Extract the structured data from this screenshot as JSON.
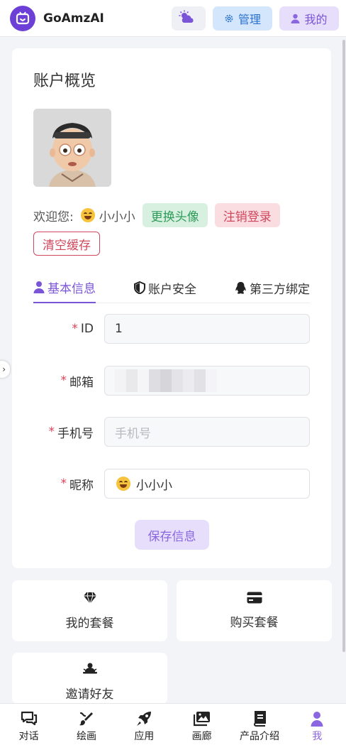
{
  "header": {
    "app_name": "GoAmzAI",
    "admin_label": "管理",
    "me_label": "我的"
  },
  "account": {
    "title": "账户概览",
    "welcome": "欢迎您:",
    "nickname": "小小小",
    "change_avatar": "更换头像",
    "logout": "注销登录",
    "clear_cache": "清空缓存"
  },
  "tabs": [
    {
      "label": "基本信息",
      "active": true
    },
    {
      "label": "账户安全",
      "active": false
    },
    {
      "label": "第三方绑定",
      "active": false
    }
  ],
  "form": {
    "required_mark": "*",
    "id_label": "ID",
    "id_value": "1",
    "email_label": "邮箱",
    "phone_label": "手机号",
    "phone_placeholder": "手机号",
    "nickname_label": "昵称",
    "nickname_value": "小小小",
    "save_label": "保存信息"
  },
  "cards": {
    "my_plan": "我的套餐",
    "buy_plan": "购买套餐",
    "invite": "邀请好友"
  },
  "nav": [
    {
      "label": "对话",
      "icon": "chat-icon"
    },
    {
      "label": "绘画",
      "icon": "brush-icon"
    },
    {
      "label": "应用",
      "icon": "rocket-icon"
    },
    {
      "label": "画廊",
      "icon": "gallery-icon"
    },
    {
      "label": "产品介绍",
      "icon": "book-icon"
    },
    {
      "label": "我",
      "icon": "user-icon",
      "active": true
    }
  ],
  "colors": {
    "accent": "#7b55d8",
    "brand": "#6c3fd6",
    "admin_blue": "#2a72d0",
    "success": "#2f9b5a",
    "danger": "#d0485e"
  }
}
